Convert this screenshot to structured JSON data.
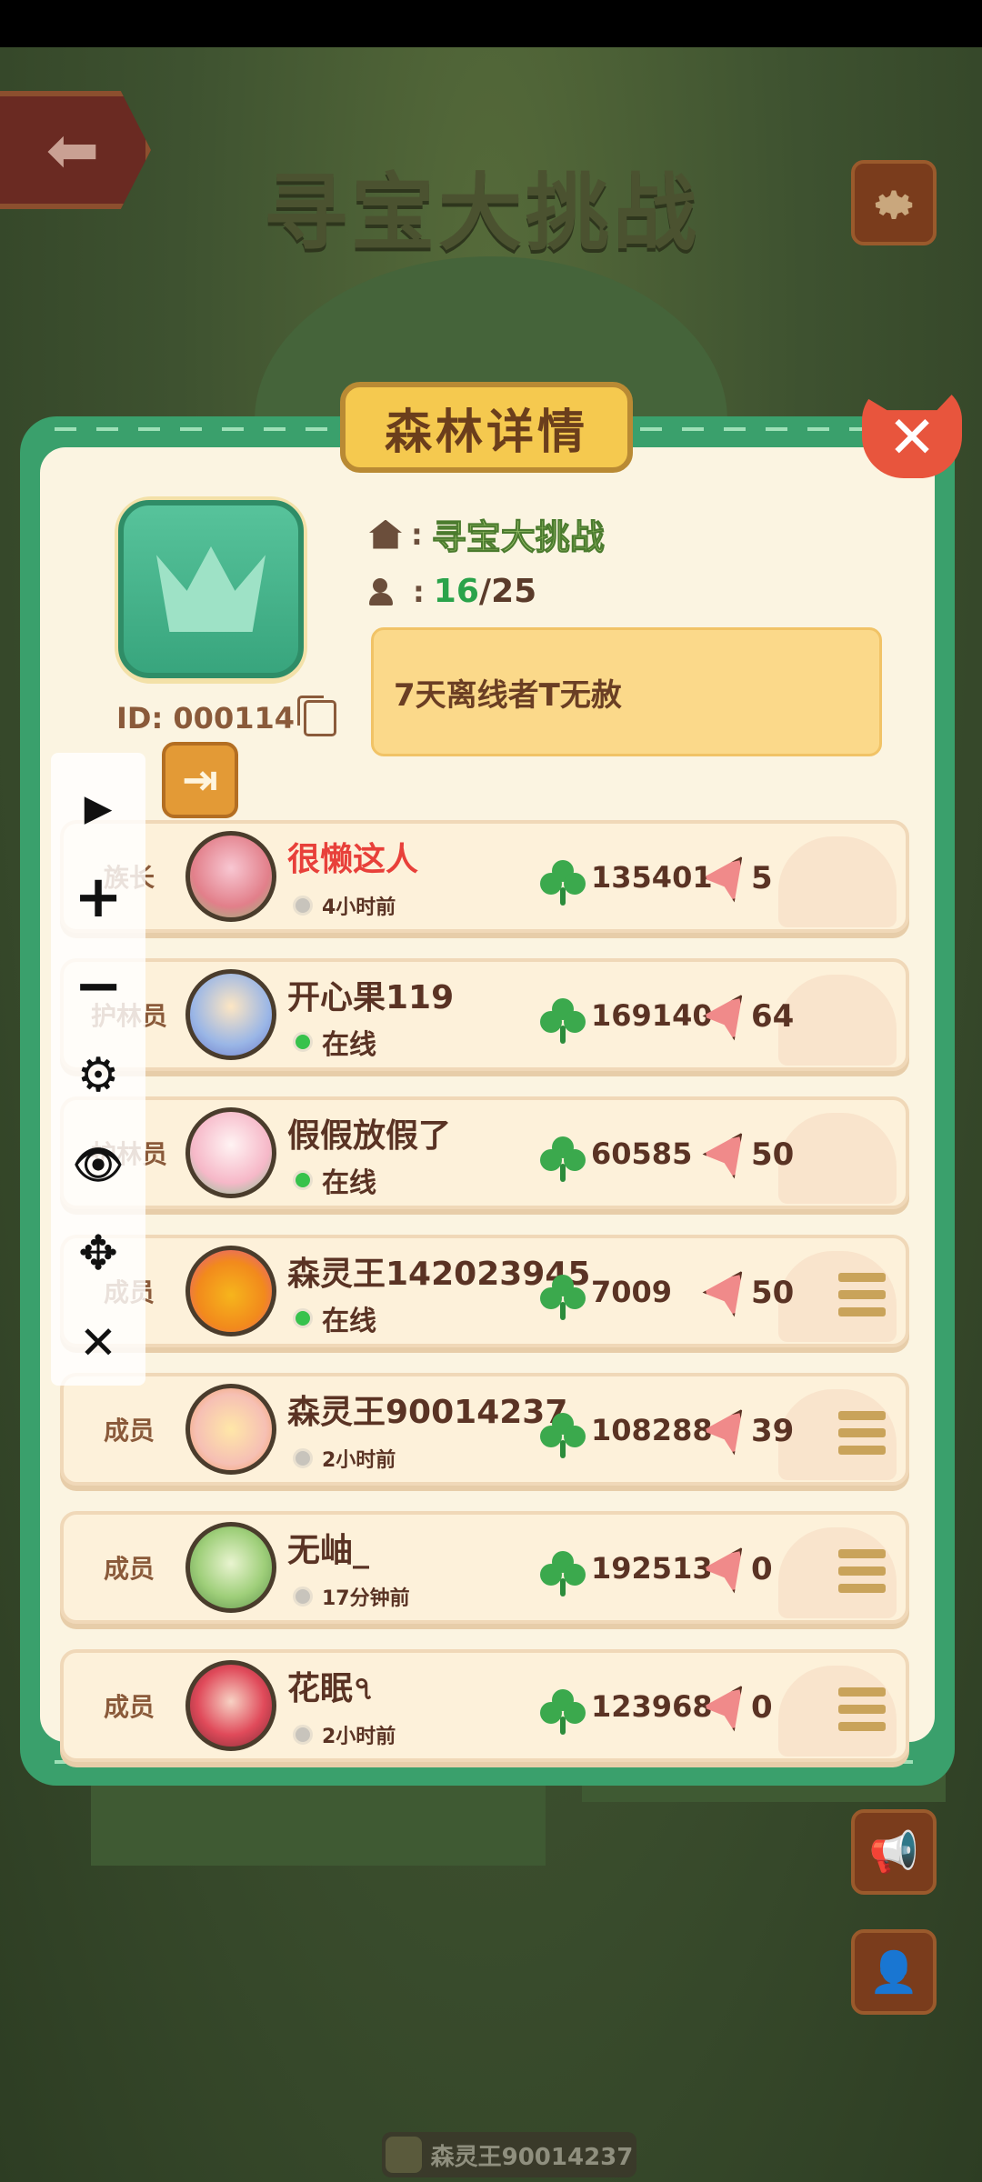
{
  "background": {
    "title": "寻宝大挑战",
    "bottom_player_name": "森灵王90014237"
  },
  "panel": {
    "title": "森林详情",
    "forest_id": "ID: 000114",
    "forest_name": "寻宝大挑战",
    "member_current": "16",
    "member_max": "25",
    "member_sep": "/",
    "notice": "7天离线者T无赦"
  },
  "members": [
    {
      "role": "族长",
      "name": "很懒这人",
      "status": "4小时前",
      "online": false,
      "clover": "135401",
      "likes": "5",
      "menu": false,
      "name_red": true
    },
    {
      "role": "护林员",
      "name": "开心果119",
      "status": "在线",
      "online": true,
      "clover": "169140",
      "likes": "64",
      "menu": false
    },
    {
      "role": "护林员",
      "name": "假假放假了",
      "status": "在线",
      "online": true,
      "clover": "60585",
      "likes": "50",
      "menu": false
    },
    {
      "role": "成员",
      "name": "森灵王142023945",
      "status": "在线",
      "online": true,
      "clover": "7009",
      "likes": "50",
      "menu": true
    },
    {
      "role": "成员",
      "name": "森灵王90014237",
      "status": "2小时前",
      "online": false,
      "clover": "108288",
      "likes": "39",
      "menu": true
    },
    {
      "role": "成员",
      "name": "无岫_",
      "status": "17分钟前",
      "online": false,
      "clover": "192513",
      "likes": "0",
      "menu": true
    },
    {
      "role": "成员",
      "name": "花眠৭",
      "status": "2小时前",
      "online": false,
      "clover": "123968",
      "likes": "0",
      "menu": true
    }
  ],
  "icons": {
    "back": "arrow-left-icon",
    "settings": "gear-icon",
    "close": "close-icon",
    "home": "house-icon",
    "members": "people-icon",
    "copy": "copy-icon",
    "exit": "exit-icon",
    "clover": "clover-icon",
    "like": "paper-plane-heart-icon",
    "menu": "hamburger-icon"
  },
  "toolbar": {
    "play": "▶",
    "zoom_in": "+",
    "zoom_out": "−",
    "settings": "⚙",
    "eye": "👁",
    "move": "✥",
    "close": "✕"
  },
  "colors": {
    "panel_green": "#3aa06c",
    "panel_cream": "#fbf4e1",
    "banner_gold": "#f5c94f",
    "online_green": "#37c24c",
    "name_red": "#e8403a"
  }
}
